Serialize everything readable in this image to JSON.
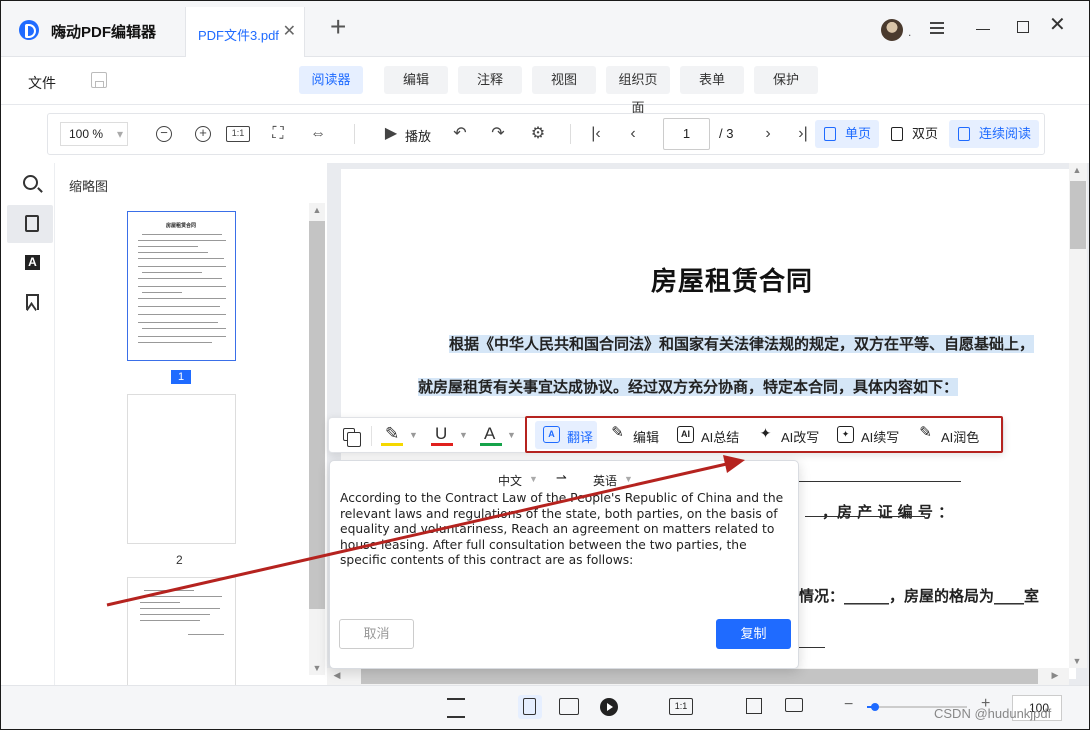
{
  "app": {
    "name": "嗨动PDF编辑器"
  },
  "tabs": [
    {
      "label": "PDF文件3.pdf"
    }
  ],
  "menubar": {
    "file_label": "文件",
    "tabs": [
      "阅读器",
      "编辑",
      "注释",
      "视图",
      "组织页面",
      "表单",
      "保护"
    ],
    "active_tab": "阅读器"
  },
  "toolbar": {
    "zoom": "100  %",
    "play_label": "播放",
    "page_current": "1",
    "page_total": "/ 3",
    "views": [
      "单页",
      "双页",
      "连续阅读"
    ],
    "active_view": "单页",
    "fit_label": "1:1"
  },
  "sidebar": {
    "title": "缩略图",
    "text_icon_glyph": "A",
    "thumbnails": [
      {
        "number": "1",
        "title": "房屋租赁合同",
        "selected": true
      },
      {
        "number": "2",
        "selected": false
      },
      {
        "number": "",
        "selected": false
      }
    ]
  },
  "document": {
    "title": "房屋租赁合同",
    "lines": [
      "根据《中华人民共和国合同法》和国家有关法律法规的规定，双方在平等、自愿基础上，",
      "就房屋租赁有关事宜达成协议。经过双方充分协商，特定本合同，具体内容如下：",
      "，房 产 证 编 号 ：",
      "情况：______，房屋的格局为____室"
    ]
  },
  "selection_toolbar": {
    "highlight_color": "#f5d800",
    "underline_color": "#e0201d",
    "strike_color": "#16a34a",
    "actions": [
      {
        "label": "翻译",
        "icon": "translate-icon",
        "glyph": "A",
        "active": true
      },
      {
        "label": "编辑",
        "icon": "pencil-icon",
        "glyph": "✎"
      },
      {
        "label": "AI总结",
        "icon": "ai-summary-icon",
        "glyph": "AI"
      },
      {
        "label": "AI改写",
        "icon": "ai-rewrite-icon",
        "glyph": "✦"
      },
      {
        "label": "AI续写",
        "icon": "ai-continue-icon",
        "glyph": "✦"
      },
      {
        "label": "AI润色",
        "icon": "ai-polish-icon",
        "glyph": "✎"
      }
    ]
  },
  "translation": {
    "source_lang": "中文",
    "arrow": "⇀",
    "target_lang": "英语",
    "text": "According to the Contract Law of the People's Republic of China and the relevant laws and regulations of the state, both parties, on the basis of equality and voluntariness, Reach an agreement on matters related to house leasing. After full consultation between the two parties, the specific contents of this contract are as follows:",
    "cancel_label": "取消",
    "copy_label": "复制"
  },
  "bottombar": {
    "fit_label": "1:1",
    "zoom_value": "100",
    "zoom_fraction": 0.08
  },
  "watermark": "CSDN @hudunkjpdf",
  "colors": {
    "accent": "#1f6bff",
    "annotation_red": "#b5231f"
  }
}
